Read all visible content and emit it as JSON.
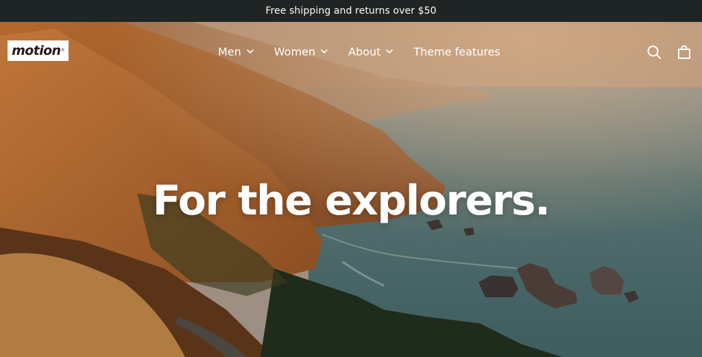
{
  "announcement": {
    "text": "Free shipping and returns over $50"
  },
  "header": {
    "logo_text": "motion",
    "logo_mark": "®",
    "nav": [
      {
        "label": "Men",
        "has_dropdown": true
      },
      {
        "label": "Women",
        "has_dropdown": true
      },
      {
        "label": "About",
        "has_dropdown": true
      },
      {
        "label": "Theme features",
        "has_dropdown": false
      }
    ],
    "icons": [
      "search-icon",
      "cart-icon"
    ]
  },
  "hero": {
    "headline": "For the explorers.",
    "image": "coastal-cliffs-sunset-photo"
  },
  "colors": {
    "announcement_bg": "#1f2424",
    "text_light": "#ffffff",
    "ocean": "#4a6a6c",
    "hills": "#8a4a1c"
  }
}
